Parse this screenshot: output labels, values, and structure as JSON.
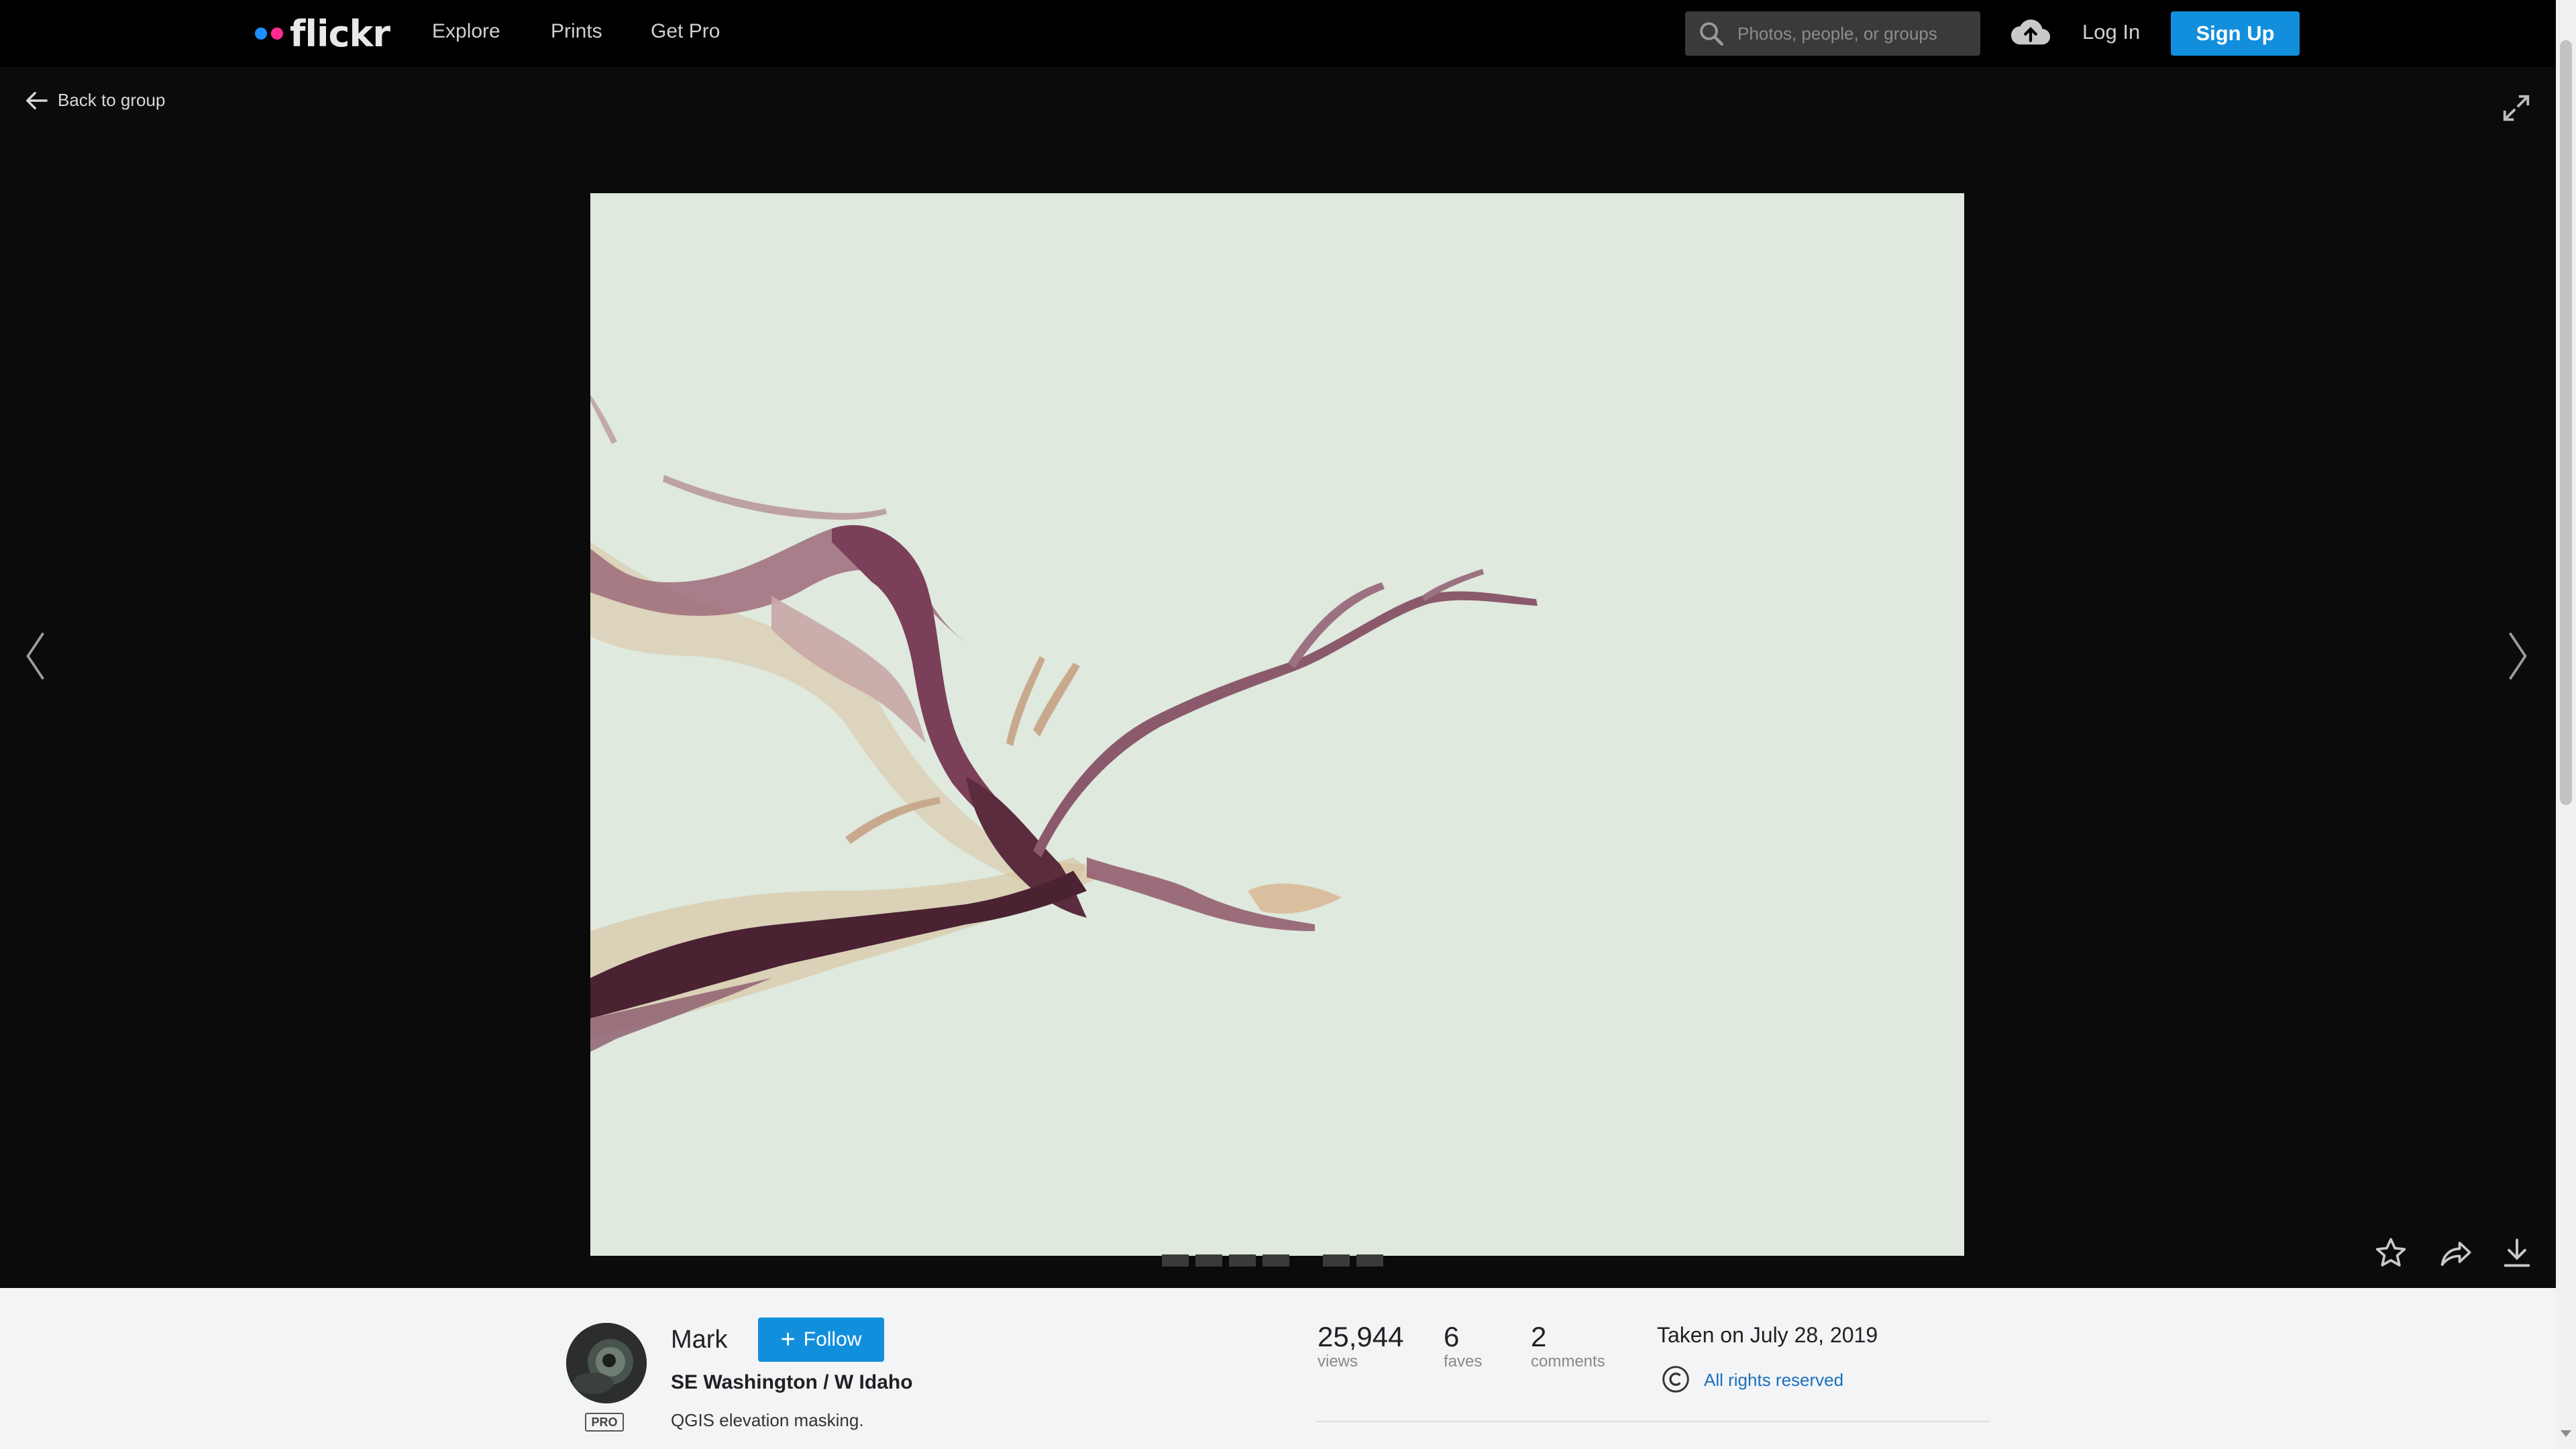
{
  "header": {
    "logo_text": "flickr",
    "nav": [
      "Explore",
      "Prints",
      "Get Pro"
    ],
    "search_placeholder": "Photos, people, or groups",
    "login_label": "Log In",
    "signup_label": "Sign Up",
    "colors": {
      "accent": "#128fdc",
      "logo_blue": "#1e8fff",
      "logo_pink": "#ff2b8f"
    }
  },
  "viewer": {
    "back_label": "Back to group",
    "icons": [
      "arrow-left-icon",
      "expand-icon",
      "chevron-left-icon",
      "chevron-right-icon",
      "star-icon",
      "share-icon",
      "download-icon"
    ]
  },
  "owner": {
    "name": "Mark",
    "badge": "PRO",
    "follow_label": "Follow"
  },
  "photo": {
    "title": "SE Washington / W Idaho",
    "description": "QGIS elevation masking.",
    "taken": "Taken on July 28, 2019",
    "license": "All rights reserved"
  },
  "stats": [
    {
      "value": "25,944",
      "label": "views"
    },
    {
      "value": "6",
      "label": "faves"
    },
    {
      "value": "2",
      "label": "comments"
    }
  ]
}
